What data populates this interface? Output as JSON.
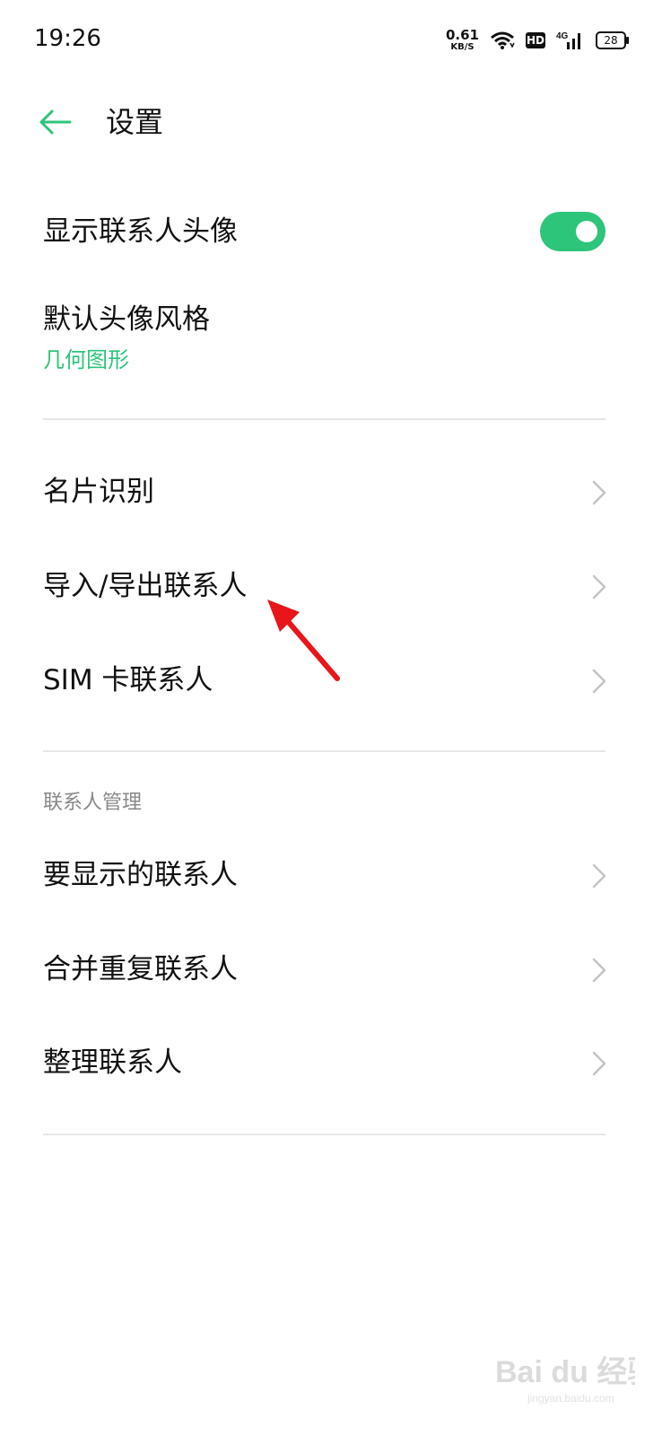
{
  "status_bar": {
    "time": "19:26",
    "net_speed_value": "0.61",
    "net_speed_unit": "KB/S",
    "hd_label": "HD",
    "signal_label": "4G",
    "battery": "28"
  },
  "header": {
    "title": "设置"
  },
  "items": {
    "show_avatar": "显示联系人头像",
    "show_avatar_on": true,
    "default_avatar_style": "默认头像风格",
    "default_avatar_style_value": "几何图形",
    "card_recognition": "名片识别",
    "import_export": "导入/导出联系人",
    "sim_contacts": "SIM 卡联系人"
  },
  "contact_management": {
    "header": "联系人管理",
    "contacts_to_display": "要显示的联系人",
    "merge_duplicates": "合并重复联系人",
    "organize_contacts": "整理联系人"
  },
  "watermark": {
    "brand": "Bai du 经验",
    "url": "jingyan.baidu.com"
  },
  "colors": {
    "accent": "#2dc57a",
    "annotation_arrow": "#e8161a"
  }
}
